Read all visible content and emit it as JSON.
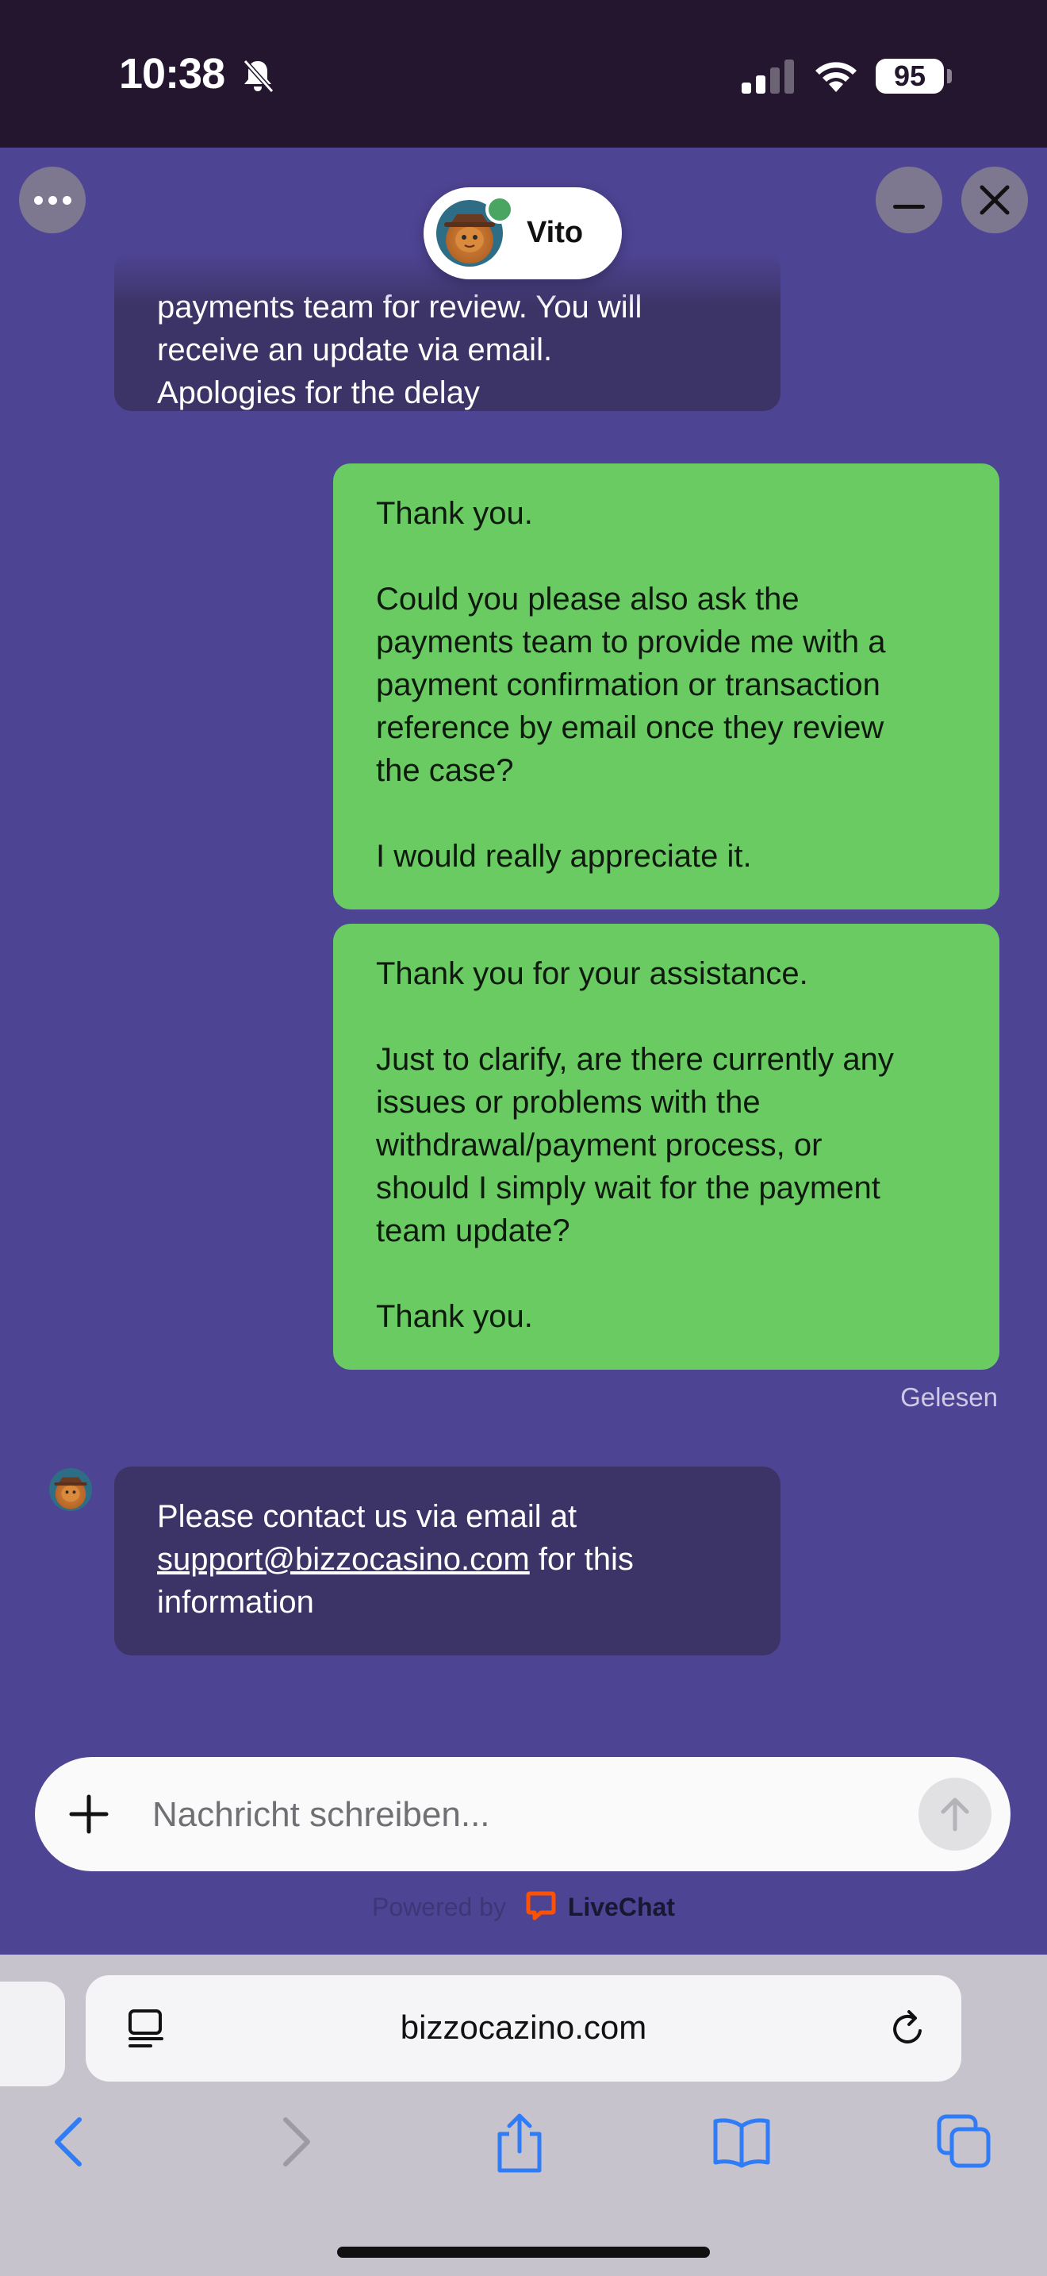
{
  "status_bar": {
    "time": "10:38",
    "battery": "95",
    "icons": [
      "bell-muted-icon",
      "signal-icon",
      "wifi-icon",
      "battery-icon"
    ]
  },
  "chat": {
    "agent_name": "Vito",
    "agent_status": "online",
    "header_icons": [
      "more-icon",
      "minimize-icon",
      "close-icon"
    ],
    "messages": [
      {
        "from": "agent",
        "lines": [
          "payments team for review. You will",
          "receive an update via email.",
          "Apologies for the delay"
        ]
      },
      {
        "from": "user",
        "lines": [
          "Thank you.",
          "",
          "Could you please also ask the",
          "payments team to provide me with a",
          "payment confirmation or transaction",
          "reference by email once they review",
          "the case?",
          "",
          "I would really appreciate it."
        ]
      },
      {
        "from": "user",
        "lines": [
          "Thank you for your assistance.",
          "",
          "Just to clarify, are there currently any",
          "issues or problems with the",
          "withdrawal/payment process, or",
          "should I simply wait for the payment",
          "team update?",
          "",
          "Thank you."
        ]
      },
      {
        "from": "agent",
        "line1": "Please contact us via email at",
        "email": "support@bizzocasino.com",
        "line2_after": " for this",
        "line3": "information"
      }
    ],
    "read_status": "Gelesen",
    "composer": {
      "placeholder": "Nachricht schreiben...",
      "value": ""
    },
    "powered_by": {
      "label": "Powered by",
      "brand": "LiveChat",
      "brand_color": "#ff5100"
    }
  },
  "browser": {
    "url": "bizzocazino.com",
    "toolbar_icons": [
      "back-icon",
      "forward-icon",
      "share-icon",
      "bookmarks-icon",
      "tabs-icon"
    ]
  },
  "colors": {
    "status_bar_bg": "#25162f",
    "chat_bg": "#4e4494",
    "agent_bubble": "#3c3466",
    "user_bubble": "#6acb63",
    "browser_bg": "#c6c3cc",
    "accent_blue": "#2f7cf6"
  }
}
